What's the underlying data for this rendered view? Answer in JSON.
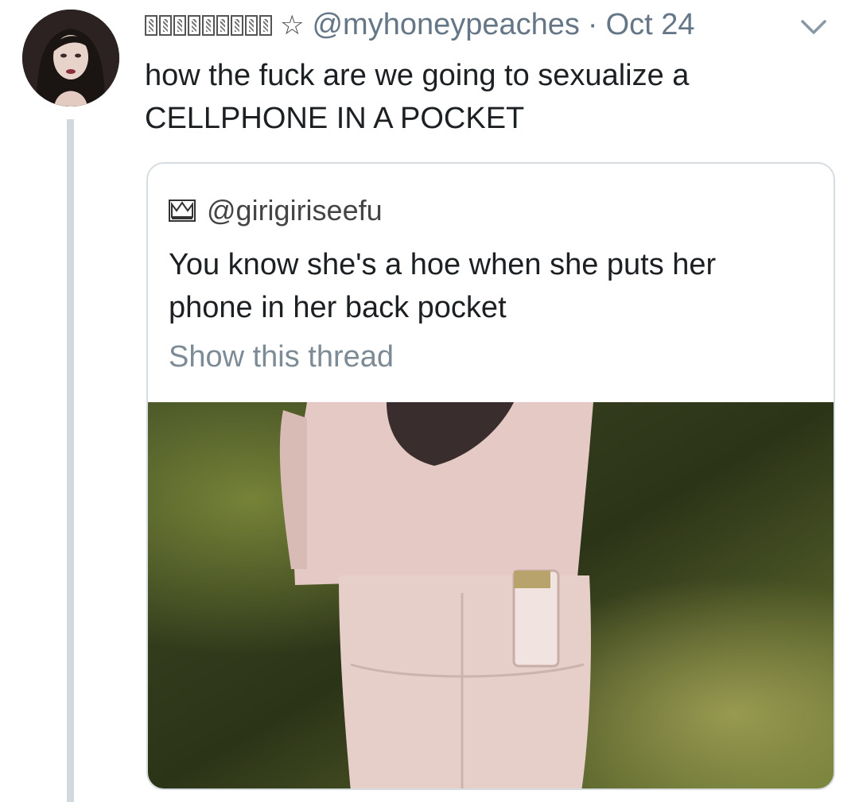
{
  "tweet": {
    "display_name_obscured": true,
    "handle": "@myhoneypeaches",
    "separator": "·",
    "date": "Oct 24",
    "text_line1": "how the fuck are we going to sexualize a",
    "text_line2": "CELLPHONE IN A POCKET"
  },
  "quoted": {
    "handle": "@girigiriseefu",
    "text_line1": "You know she's a hoe when she puts her",
    "text_line2": "phone in her back pocket",
    "show_thread": "Show this thread"
  },
  "colors": {
    "muted": "#657786",
    "border": "#d6dde2",
    "thread_line": "#cfd9de"
  },
  "icons": {
    "star": "star-outline-icon",
    "chevron": "chevron-down-icon",
    "crown": "crown-icon"
  }
}
